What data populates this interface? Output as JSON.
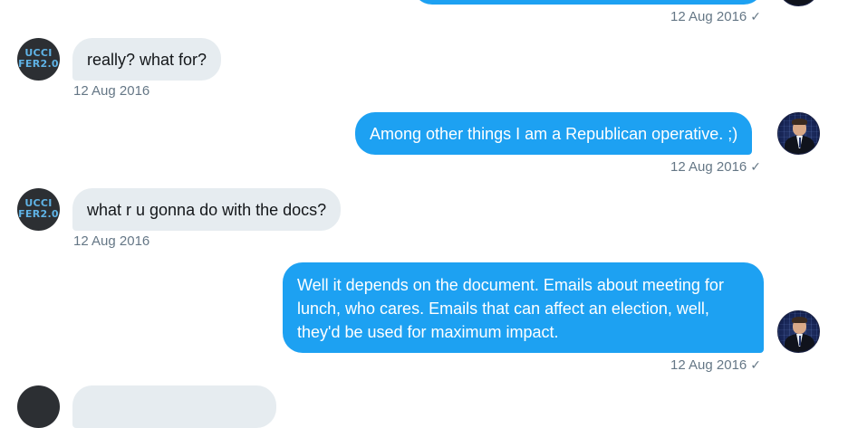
{
  "conversation": {
    "top": {
      "timestamp": "12 Aug 2016"
    },
    "messages": [
      {
        "direction": "in",
        "text": "really? what for?",
        "timestamp": "12 Aug 2016"
      },
      {
        "direction": "out",
        "text": "Among other things I am a Republican operative. ;)",
        "timestamp": "12 Aug 2016"
      },
      {
        "direction": "in",
        "text": "what r u gonna do with the docs?",
        "timestamp": "12 Aug 2016"
      },
      {
        "direction": "out",
        "text": "Well it depends on the document. Emails about meeting for lunch, who cares. Emails that can affect an election, well, they'd be used for maximum impact.",
        "timestamp": "12 Aug 2016"
      }
    ],
    "read_mark": "✓"
  },
  "avatars": {
    "guccifer": {
      "line1": "UCCI",
      "line2": "FER2.0"
    }
  },
  "colors": {
    "outgoing_bubble": "#1da1f2",
    "incoming_bubble": "#e6ecf0",
    "timestamp": "#657786"
  }
}
